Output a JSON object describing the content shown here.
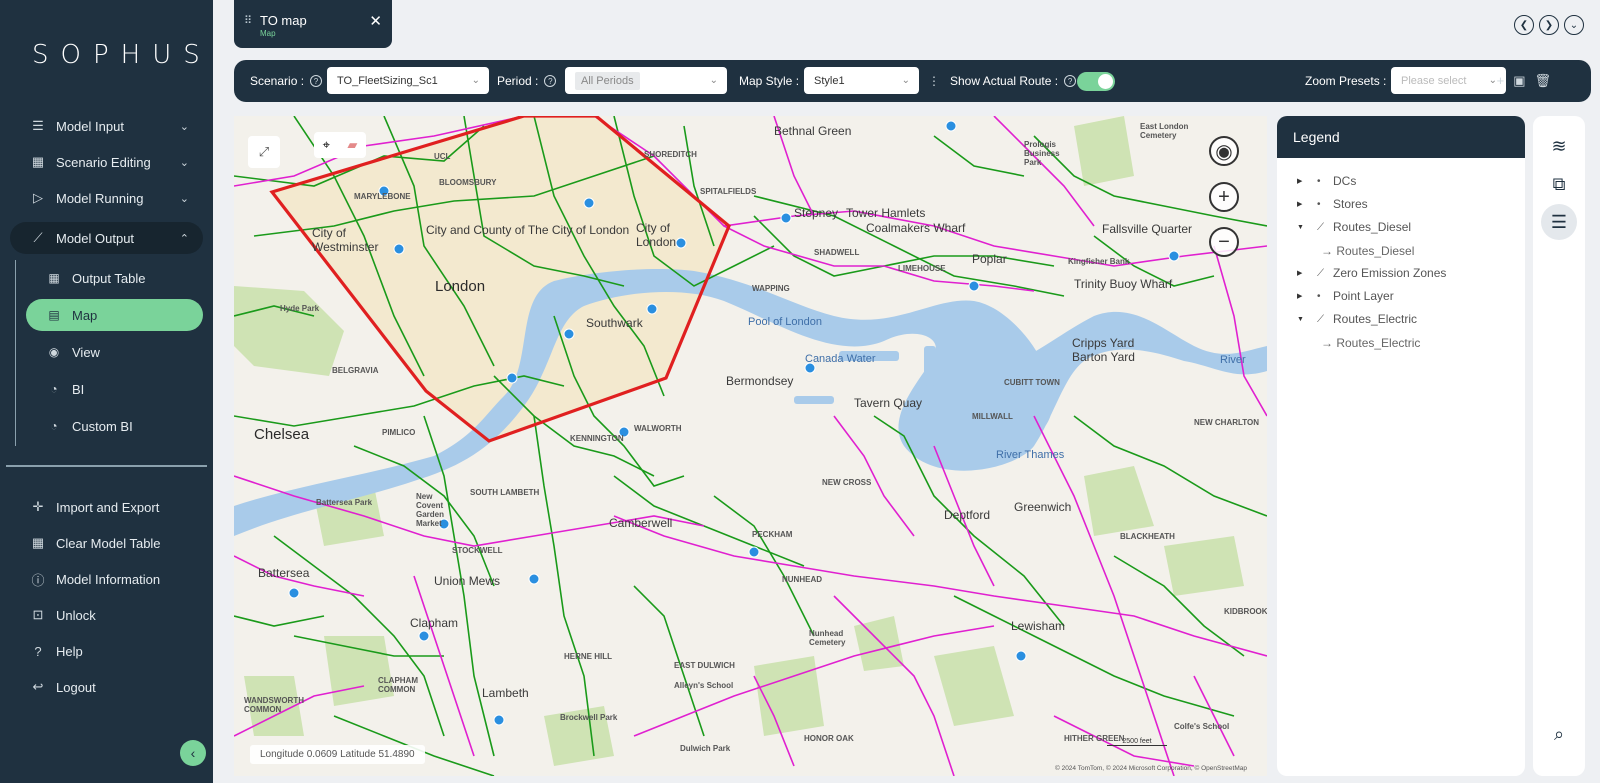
{
  "app": {
    "logo": "SOPHUS"
  },
  "sidebar": {
    "items": [
      {
        "label": "Model Input",
        "icon": "list-icon",
        "chev": "⌄"
      },
      {
        "label": "Scenario Editing",
        "icon": "chart-icon",
        "chev": "⌄"
      },
      {
        "label": "Model Running",
        "icon": "play-icon",
        "chev": "⌄"
      },
      {
        "label": "Model Output",
        "icon": "line-chart-icon",
        "chev": "⌃"
      }
    ],
    "sub_items": [
      {
        "label": "Output Table",
        "icon": "table-icon"
      },
      {
        "label": "Map",
        "icon": "map-icon"
      },
      {
        "label": "View",
        "icon": "view-icon"
      },
      {
        "label": "BI",
        "icon": "bi-icon"
      },
      {
        "label": "Custom BI",
        "icon": "custom-bi-icon"
      }
    ],
    "bottom_items": [
      {
        "label": "Import and Export",
        "icon": "import-export-icon"
      },
      {
        "label": "Clear Model Table",
        "icon": "clear-table-icon"
      },
      {
        "label": "Model Information",
        "icon": "info-icon"
      },
      {
        "label": "Unlock",
        "icon": "unlock-icon"
      },
      {
        "label": "Help",
        "icon": "help-icon"
      },
      {
        "label": "Logout",
        "icon": "logout-icon"
      }
    ]
  },
  "tab": {
    "title": "TO map",
    "subtitle": "Map"
  },
  "toolbar": {
    "scenario_label": "Scenario :",
    "scenario_value": "TO_FleetSizing_Sc1",
    "period_label": "Period :",
    "period_value": "All Periods",
    "map_style_label": "Map Style :",
    "map_style_value": "Style1",
    "show_route_label": "Show Actual Route :",
    "show_route_on": true,
    "zoom_presets_label": "Zoom Presets :",
    "zoom_presets_placeholder": "Please select"
  },
  "map": {
    "labels": [
      "Bethnal Green",
      "Tower Hamlets",
      "Stepney",
      "Coalmakers Wharf",
      "Poplar",
      "Fallsville Quarter",
      "Trinity Buoy Wharf",
      "Kingfisher Bank",
      "City of Westminster",
      "City and County of The City of London",
      "City of London",
      "London",
      "Southwark",
      "Pool of London",
      "Canada Water",
      "Bermondsey",
      "Tavern Quay",
      "Cripps Yard",
      "Barton Yard",
      "River Thames",
      "Chelsea",
      "Lambeth",
      "Hyde Park",
      "Battersea Park",
      "New Covent Garden Market",
      "Union Mews",
      "Camberwell",
      "Deptford",
      "Greenwich",
      "Battersea",
      "Clapham",
      "Lewisham",
      "Nunhead Cemetery",
      "Brockwell Park",
      "Dulwich Park",
      "Alleyn's School",
      "MARYLEBONE",
      "BLOOMSBURY",
      "UCL",
      "SHOREDITCH",
      "SPITALFIELDS",
      "WAPPING",
      "SHADWELL",
      "LIMEHOUSE",
      "MILLWALL",
      "CUBITT TOWN",
      "NEW CHARLTON",
      "NEW CROSS",
      "PECKHAM",
      "NUNHEAD",
      "KIDBROOKE",
      "BLACKHEATH",
      "EAST DULWICH",
      "HERNE HILL",
      "STOCKWELL",
      "KENNINGTON",
      "WALWORTH",
      "PIMLICO",
      "BELGRAVIA",
      "SOUTH LAMBETH",
      "CLAPHAM COMMON",
      "WANDSWORTH COMMON",
      "HONOR OAK",
      "HITHER GREEN",
      "Colfe's School",
      "East London Cemetery",
      "Prologis Business Park",
      "River"
    ],
    "coords_text": "Longitude  0.0609   Latitude  51.4890",
    "attribution": "© 2024 TomTom, © 2024 Microsoft Corporation, © OpenStreetMap",
    "scale": "2500 feet"
  },
  "legend": {
    "title": "Legend",
    "items": [
      {
        "label": "DCs",
        "sym": "•",
        "expanded": false
      },
      {
        "label": "Stores",
        "sym": "•",
        "expanded": false
      },
      {
        "label": "Routes_Diesel",
        "sym": "⟋",
        "expanded": true,
        "child": "Routes_Diesel"
      },
      {
        "label": "Zero Emission Zones",
        "sym": "⟋",
        "expanded": false
      },
      {
        "label": "Point Layer",
        "sym": "•",
        "expanded": false
      },
      {
        "label": "Routes_Electric",
        "sym": "⟋",
        "expanded": true,
        "child": "Routes_Electric"
      }
    ]
  },
  "colors": {
    "sidebar_bg": "#1f3140",
    "accent_green": "#7ad39a",
    "route_diesel": "#e020d0",
    "route_electric": "#1a9a1a",
    "zero_emission_zone": "#e02020",
    "store_marker": "#2a8fe0",
    "water": "#a9cbea"
  }
}
